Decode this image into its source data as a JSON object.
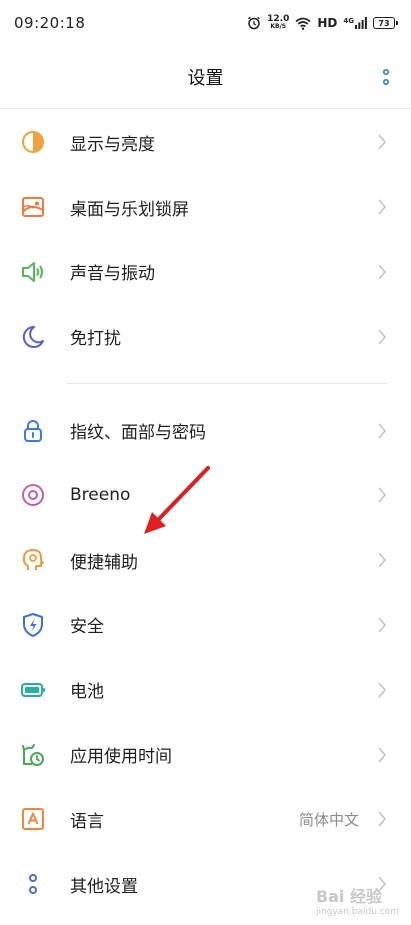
{
  "status": {
    "time": "09:20:18",
    "net_speed": "12.0",
    "net_unit": "KB/S",
    "hd": "HD",
    "signal": "4G",
    "battery": "73"
  },
  "header": {
    "title": "设置"
  },
  "groups": [
    [
      {
        "label": "显示与亮度",
        "icon": "display-brightness-icon",
        "color": "#f0a23b"
      },
      {
        "label": "桌面与乐划锁屏",
        "icon": "wallpaper-icon",
        "color": "#f07a3b"
      },
      {
        "label": "声音与振动",
        "icon": "speaker-icon",
        "color": "#4fb85e"
      },
      {
        "label": "免打扰",
        "icon": "moon-icon",
        "color": "#5a5bd6"
      }
    ],
    [
      {
        "label": "指纹、面部与密码",
        "icon": "lock-icon",
        "color": "#3b7be8"
      },
      {
        "label": "Breeno",
        "icon": "breeno-icon",
        "color": "#e0458f"
      },
      {
        "label": "便捷辅助",
        "icon": "assist-head-icon",
        "color": "#f39b3b"
      },
      {
        "label": "安全",
        "icon": "shield-icon",
        "color": "#3b6fe0"
      },
      {
        "label": "电池",
        "icon": "battery-icon",
        "color": "#22b39a"
      },
      {
        "label": "应用使用时间",
        "icon": "app-timer-icon",
        "color": "#4aa85a"
      },
      {
        "label": "语言",
        "icon": "language-icon",
        "color": "#f0863b",
        "value": "简体中文"
      },
      {
        "label": "其他设置",
        "icon": "other-settings-icon",
        "color": "#4a6fd0"
      }
    ]
  ],
  "watermark": {
    "main": "Bai 经验",
    "sub": "jingyan.baidu.com"
  }
}
